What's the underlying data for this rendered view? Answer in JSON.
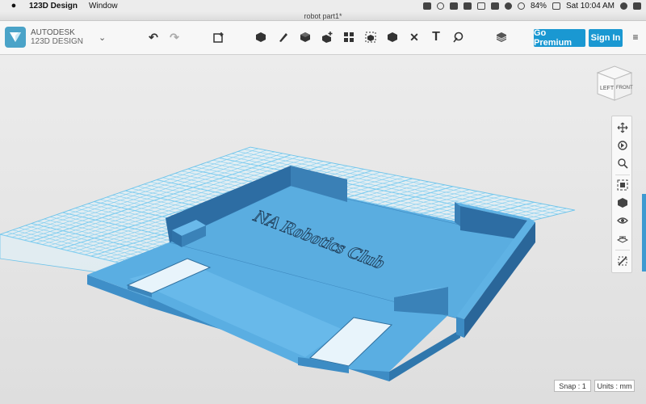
{
  "menubar": {
    "app_name": "123D Design",
    "menus": [
      "Window"
    ],
    "battery": "84%",
    "clock": "Sat 10:04 AM"
  },
  "window": {
    "title": "robot part1*"
  },
  "brand": {
    "line1": "AUTODESK",
    "line2": "123D DESIGN"
  },
  "toolbar": {
    "tools": [
      {
        "name": "undo-icon",
        "glyph": "↶"
      },
      {
        "name": "redo-icon",
        "glyph": "↷"
      },
      {
        "name": "transform-icon"
      },
      {
        "name": "primitives-icon"
      },
      {
        "name": "sketch-icon"
      },
      {
        "name": "construct-icon"
      },
      {
        "name": "modify-icon"
      },
      {
        "name": "pattern-icon"
      },
      {
        "name": "group-icon"
      },
      {
        "name": "combine-icon"
      },
      {
        "name": "measure-icon",
        "glyph": "✕"
      },
      {
        "name": "text-icon",
        "glyph": "T"
      },
      {
        "name": "snap-icon"
      },
      {
        "name": "material-icon"
      }
    ],
    "go_premium": "Go Premium",
    "sign_in": "Sign In"
  },
  "viewcube": {
    "left": "LEFT",
    "front": "FRONT"
  },
  "model": {
    "engraved_text": "NA Robotics Club"
  },
  "status": {
    "snap": "Snap : 1",
    "units": "Units : mm"
  },
  "colors": {
    "accent": "#1a98d2",
    "model_top": "#5aaee2",
    "grid": "#7fcdf0"
  }
}
